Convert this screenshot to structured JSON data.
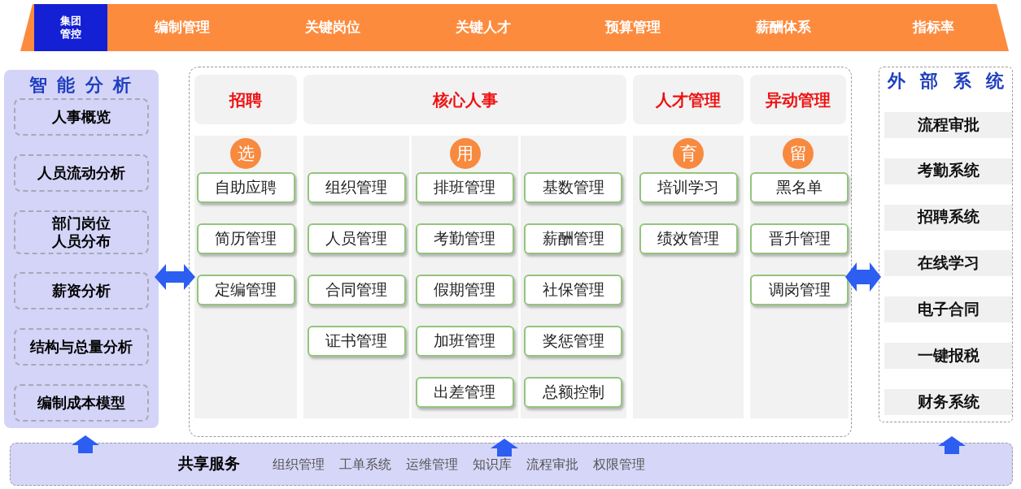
{
  "top_nav": [
    {
      "lines": [
        "集团",
        "管控"
      ],
      "selected": true
    },
    {
      "lines": [
        "编制管理"
      ],
      "selected": false
    },
    {
      "lines": [
        "关键岗位"
      ],
      "selected": false
    },
    {
      "lines": [
        "关键人才"
      ],
      "selected": false
    },
    {
      "lines": [
        "预算管理"
      ],
      "selected": false
    },
    {
      "lines": [
        "薪酬体系"
      ],
      "selected": false
    },
    {
      "lines": [
        "指标率"
      ],
      "selected": false
    }
  ],
  "analysis_panel": {
    "title": "智 能 分 析",
    "items": [
      [
        "人事概览"
      ],
      [
        "人员流动分析"
      ],
      [
        "部门岗位",
        "人员分布"
      ],
      [
        "薪资分析"
      ],
      [
        "结构与总量分析"
      ],
      [
        "编制成本模型"
      ]
    ]
  },
  "modules": [
    {
      "header": "招聘",
      "badge": "选",
      "columns": [
        [
          "自助应聘",
          "简历管理",
          "定编管理"
        ]
      ]
    },
    {
      "header": "核心人事",
      "badge": "用",
      "columns": [
        [
          "组织管理",
          "人员管理",
          "合同管理",
          "证书管理"
        ],
        [
          "排班管理",
          "考勤管理",
          "假期管理",
          "加班管理",
          "出差管理"
        ],
        [
          "基数管理",
          "薪酬管理",
          "社保管理",
          "奖惩管理",
          "总额控制"
        ]
      ]
    },
    {
      "header": "人才管理",
      "badge": "育",
      "columns": [
        [
          "培训学习",
          "绩效管理"
        ]
      ]
    },
    {
      "header": "异动管理",
      "badge": "留",
      "columns": [
        [
          "黑名单",
          "晋升管理",
          "调岗管理"
        ]
      ]
    }
  ],
  "external_panel": {
    "title": "外 部 系 统",
    "items": [
      "流程审批",
      "考勤系统",
      "招聘系统",
      "在线学习",
      "电子合同",
      "一键报税",
      "财务系统"
    ]
  },
  "shared_services": {
    "title": "共享服务",
    "items": [
      "组织管理",
      "工单系统",
      "运维管理",
      "知识库",
      "流程审批",
      "权限管理"
    ]
  }
}
